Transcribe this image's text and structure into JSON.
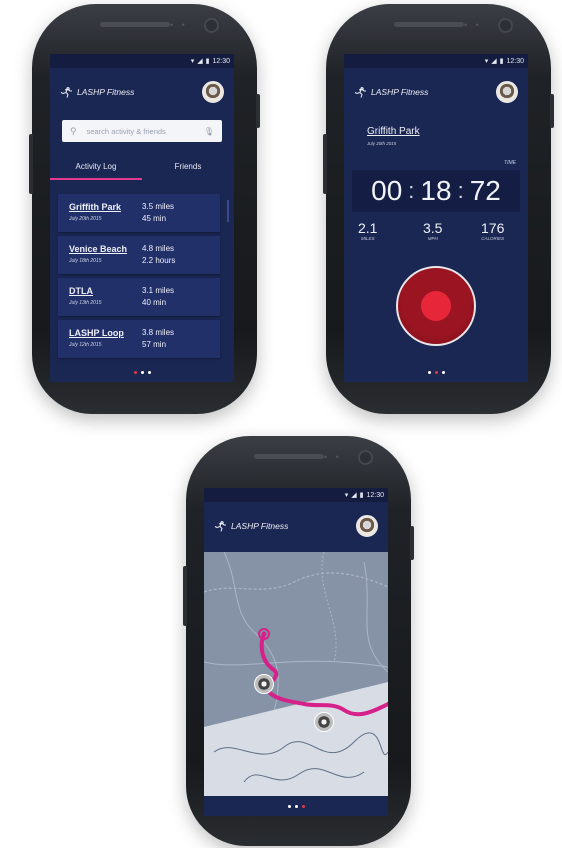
{
  "status": {
    "time": "12:30",
    "wifi_icon": "wifi-icon",
    "signal_icon": "signal-icon",
    "battery_icon": "battery-icon"
  },
  "app": {
    "name": "LASHP Fitness",
    "logo_icon": "runner-icon",
    "avatar_icon": "profile-avatar"
  },
  "screen1": {
    "search_placeholder": "search activity & friends",
    "tabs": [
      {
        "label": "Activity Log",
        "active": true
      },
      {
        "label": "Friends",
        "active": false
      }
    ],
    "activities": [
      {
        "place": "Griffith Park",
        "date": "July 20th 2015",
        "distance": "3.5 miles",
        "duration": "45 min"
      },
      {
        "place": "Venice Beach",
        "date": "July 18th 2015",
        "distance": "4.8 miles",
        "duration": "2.2 hours"
      },
      {
        "place": "DTLA",
        "date": "July 13th 2015",
        "distance": "3.1 miles",
        "duration": "40 min"
      },
      {
        "place": "LASHP Loop",
        "date": "July 12th 2015",
        "distance": "3.8 miles",
        "duration": "57 min"
      }
    ],
    "pager_active": 0
  },
  "screen2": {
    "place": "Griffith Park",
    "date": "July 20th 2015",
    "time_label": "TIME",
    "time": {
      "hours": "00",
      "minutes": "18",
      "seconds": "72"
    },
    "stats": [
      {
        "value": "2.1",
        "label": "MILES"
      },
      {
        "value": "3.5",
        "label": "MPH"
      },
      {
        "value": "176",
        "label": "CALORIES"
      }
    ],
    "pager_active": 1
  },
  "screen3": {
    "route_color": "#d6208a",
    "pager_active": 2
  },
  "colors": {
    "screen_bg": "#1b2753",
    "accent_pink": "#e23a8d",
    "record_red": "#e8263a"
  }
}
